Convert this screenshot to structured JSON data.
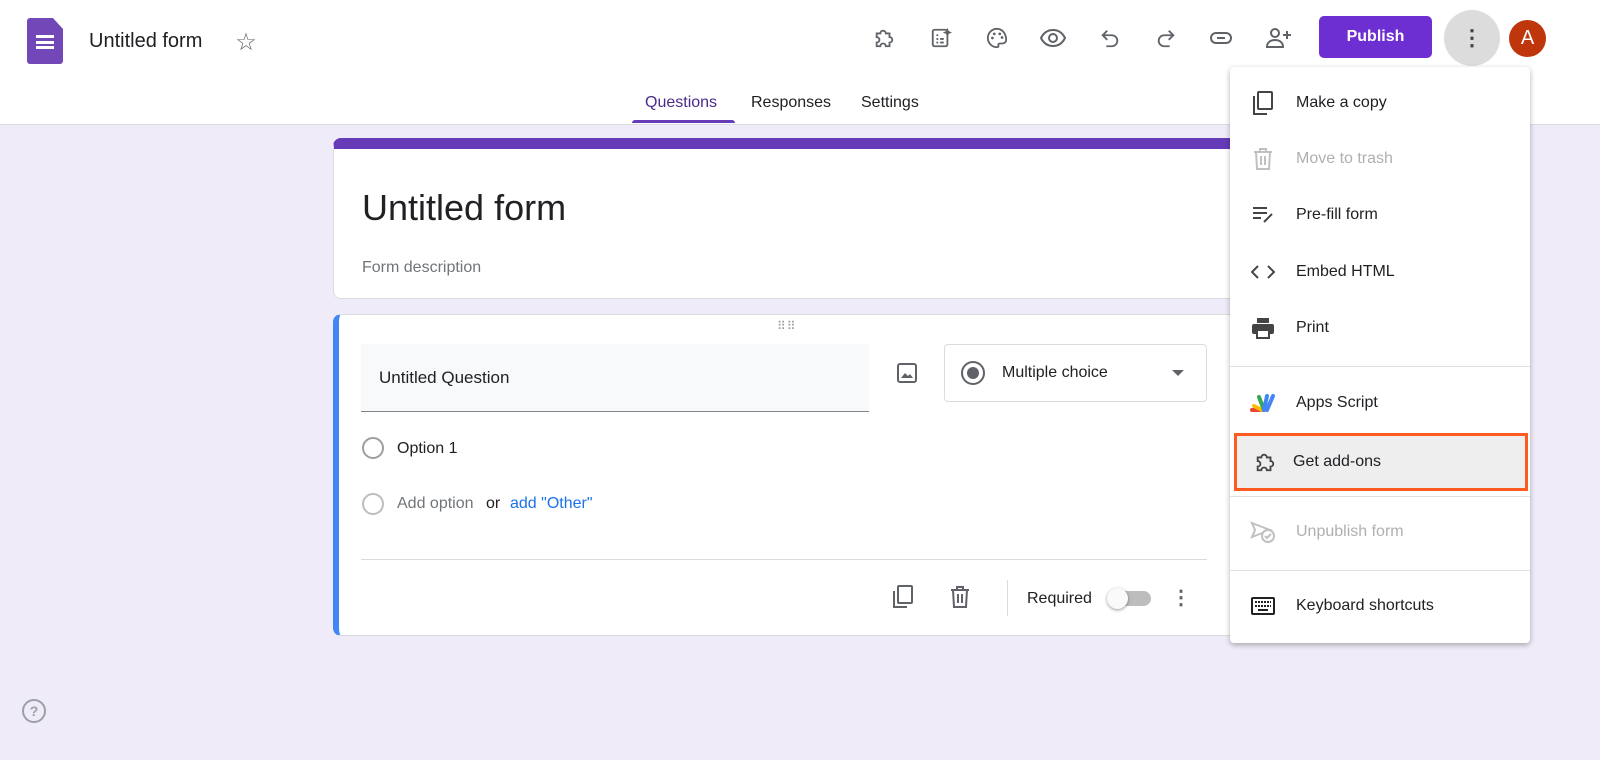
{
  "header": {
    "doc_title": "Untitled form",
    "publish_label": "Publish",
    "avatar_letter": "A",
    "toolbar_icons": [
      "addons-icon",
      "ai-form-icon",
      "palette-icon",
      "preview-icon",
      "undo-icon",
      "redo-icon",
      "link-icon",
      "add-collaborator-icon"
    ]
  },
  "tabs": [
    {
      "label": "Questions",
      "active": true
    },
    {
      "label": "Responses"
    },
    {
      "label": "Settings"
    }
  ],
  "form": {
    "title": "Untitled form",
    "description_placeholder": "Form description"
  },
  "question": {
    "title": "Untitled Question",
    "type": "Multiple choice",
    "option1": "Option 1",
    "add_option": "Add option",
    "or": "or",
    "add_other": "add \"Other\"",
    "required_label": "Required",
    "required": false
  },
  "menu": {
    "items": [
      {
        "label": "Make a copy",
        "icon": "copy-icon"
      },
      {
        "label": "Move to trash",
        "icon": "trash-icon",
        "disabled": true
      },
      {
        "label": "Pre-fill form",
        "icon": "prefill-icon"
      },
      {
        "label": "Embed HTML",
        "icon": "code-icon"
      },
      {
        "label": "Print",
        "icon": "print-icon"
      },
      {
        "label": "Apps Script",
        "icon": "apps-script-icon"
      },
      {
        "label": "Get add-ons",
        "icon": "addons-icon",
        "highlighted": true
      },
      {
        "label": "Unpublish form",
        "icon": "unpublish-icon",
        "disabled": true
      },
      {
        "label": "Keyboard shortcuts",
        "icon": "keyboard-icon"
      }
    ]
  },
  "colors": {
    "accent": "#673ab7",
    "publish": "#6d2fd1",
    "highlight_border": "#ff5a1f",
    "question_border": "#4285f4",
    "background": "#f0ebf8"
  }
}
